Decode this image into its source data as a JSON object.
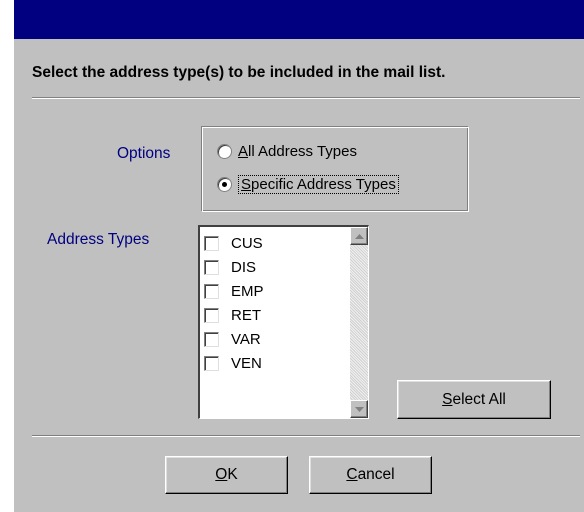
{
  "dialog": {
    "instruction": "Select the address type(s) to be included in the mail list."
  },
  "options": {
    "label": "Options",
    "radios": [
      {
        "mnemonic": "A",
        "rest": "ll Address Types",
        "selected": false
      },
      {
        "mnemonic": "S",
        "rest": "pecific Address Types",
        "selected": true
      }
    ]
  },
  "address_types": {
    "label": "Address Types",
    "items": [
      {
        "code": "CUS",
        "checked": false
      },
      {
        "code": "DIS",
        "checked": false
      },
      {
        "code": "EMP",
        "checked": false
      },
      {
        "code": "RET",
        "checked": false
      },
      {
        "code": "VAR",
        "checked": false
      },
      {
        "code": "VEN",
        "checked": false
      }
    ]
  },
  "buttons": {
    "select_all": {
      "mnemonic": "S",
      "rest": "elect All"
    },
    "ok": {
      "mnemonic": "O",
      "rest": "K"
    },
    "cancel": {
      "mnemonic": "C",
      "rest": "ancel"
    }
  },
  "icons": {
    "scroll_up": "scroll-up-arrow-icon",
    "scroll_down": "scroll-down-arrow-icon"
  },
  "colors": {
    "title_bar": "#000080",
    "dialog_face": "#c0c0c0",
    "label_text": "#000080"
  }
}
